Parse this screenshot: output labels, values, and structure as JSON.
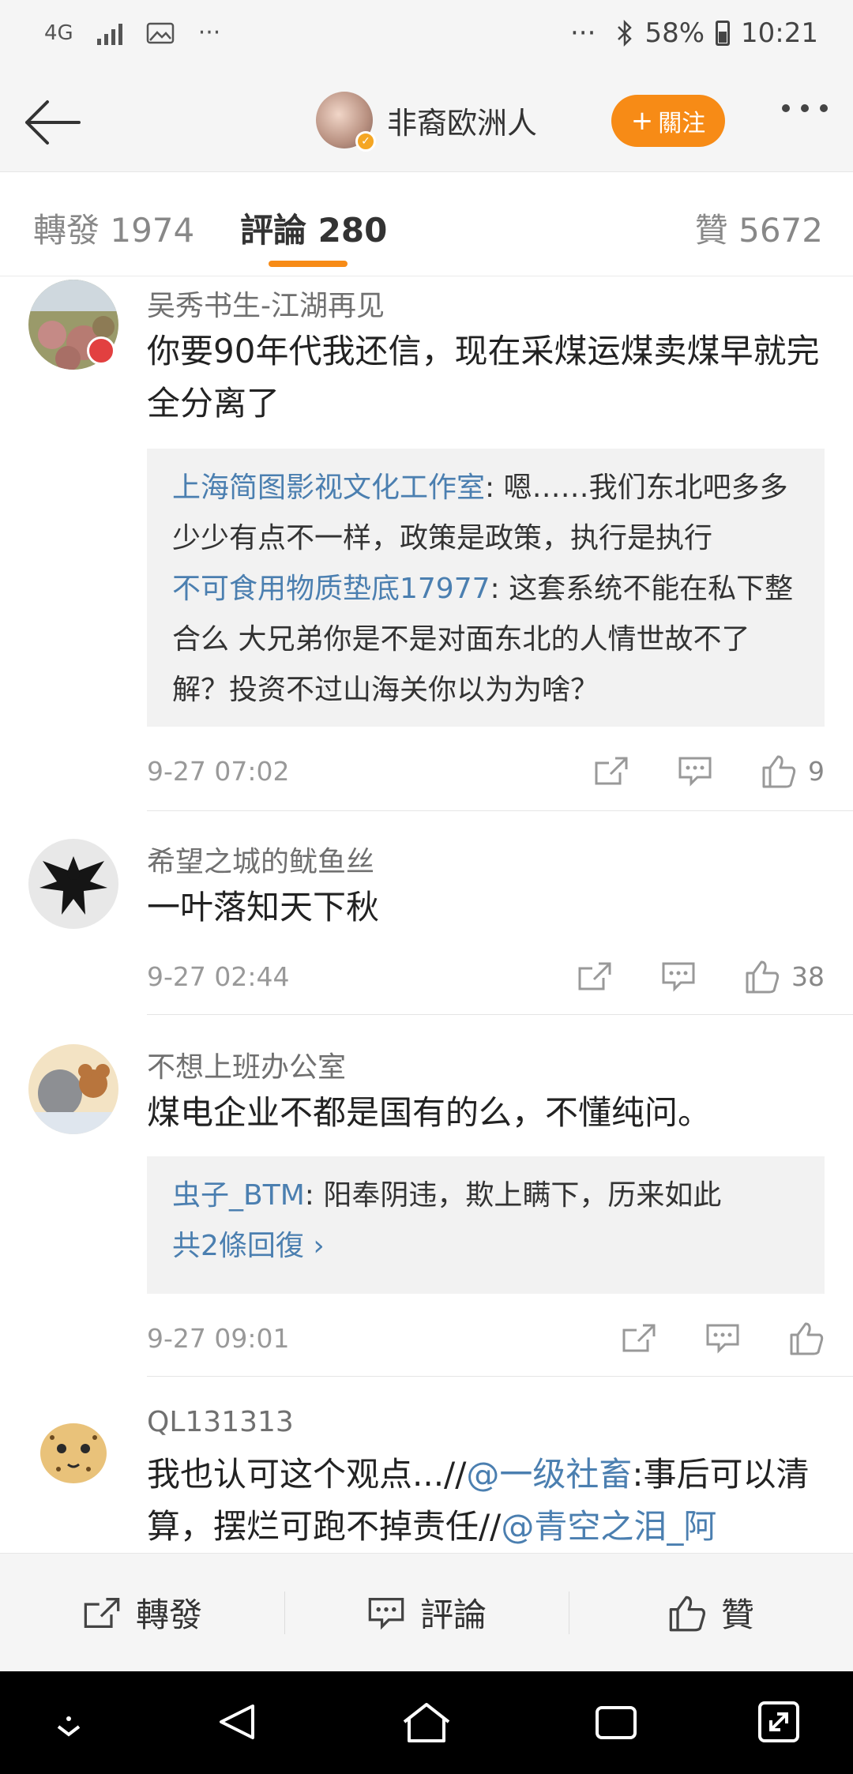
{
  "status_bar": {
    "network": "4G",
    "more": "···",
    "more_right": "···",
    "battery": "58%",
    "time": "10:21"
  },
  "header": {
    "author_name": "非裔欧洲人",
    "follow_label": "關注"
  },
  "tabs": [
    {
      "label": "轉發 1974"
    },
    {
      "label": "評論 280"
    },
    {
      "label": "贊 5672"
    }
  ],
  "comments": [
    {
      "username": "吴秀书生-江湖再见",
      "text": "你要90年代我还信，现在采煤运煤卖煤早就完全分离了",
      "replies": [
        {
          "name": "上海简图影视文化工作室",
          "text": ": 嗯……我们东北吧多多少少有点不一样，政策是政策，执行是执行"
        },
        {
          "name": "不可食用物质垫底17977",
          "text": ": 这套系统不能在私下整合么  大兄弟你是不是对面东北的人情世故不了解？投资不过山海关你以为为啥？"
        }
      ],
      "time": "9-27 07:02",
      "likes": "9"
    },
    {
      "username": "希望之城的鱿鱼丝",
      "text": "一叶落知天下秋",
      "time": "9-27 02:44",
      "likes": "38"
    },
    {
      "username": "不想上班办公室",
      "text": "煤电企业不都是国有的么，不懂纯问。",
      "replies": [
        {
          "name": "虫子_BTM",
          "text": ": 阳奉阴违，欺上瞒下，历来如此"
        }
      ],
      "more_replies": "共2條回復 ›",
      "time": "9-27 09:01"
    },
    {
      "username": "QL131313",
      "text_a": "我也认可这个观点...//",
      "mention_a": "@一级社畜",
      "text_b": ":事后可以清算，摆烂可跑不掉责任//",
      "mention_b": "@青空之泪_阿"
    }
  ],
  "bottom_bar": {
    "repost": "轉發",
    "comment": "評論",
    "like": "贊"
  },
  "colors": {
    "accent": "#f78b16",
    "link": "#4b7fb0",
    "background": "#f5f5f5"
  }
}
